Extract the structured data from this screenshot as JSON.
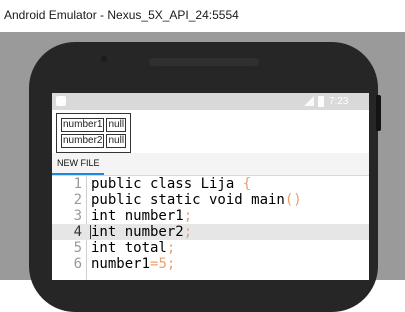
{
  "window": {
    "title": "Android Emulator - Nexus_5X_API_24:5554"
  },
  "status_bar": {
    "time": "7:23"
  },
  "variables": [
    {
      "name": "number1",
      "value": "null"
    },
    {
      "name": "number2",
      "value": "null"
    }
  ],
  "tabs": [
    {
      "label": "NEW FILE"
    }
  ],
  "editor": {
    "active_line": 4,
    "lines": [
      {
        "num": "1",
        "code": "public class Lija ",
        "sym": "{"
      },
      {
        "num": "2",
        "code": " public static void main",
        "sym": "()"
      },
      {
        "num": "3",
        "code": " int number1",
        "sym": ";"
      },
      {
        "num": "4",
        "code": "int number2",
        "sym": ";"
      },
      {
        "num": "5",
        "code": " int total",
        "sym": ";"
      },
      {
        "num": "6",
        "code": " number1",
        "sym": "=5;"
      }
    ]
  },
  "colors": {
    "accent": "#1e88e5",
    "symbol": "#e8a072",
    "emulator_background": "#9a9a9a"
  }
}
